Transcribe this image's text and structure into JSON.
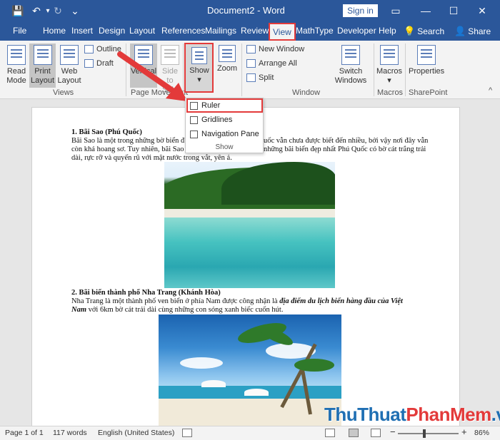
{
  "titlebar": {
    "title": "Document2 - Word",
    "signin": "Sign in",
    "save_icon": "💾",
    "undo_icon": "↶",
    "dropdown_icon": "▾",
    "redo_icon": "↻",
    "customize_icon": "⌄",
    "restore_icon": "▭",
    "minimize_icon": "—",
    "maximize_icon": "☐",
    "close_icon": "✕"
  },
  "tabs": {
    "file": "File",
    "home": "Home",
    "insert": "Insert",
    "design": "Design",
    "layout": "Layout",
    "references": "References",
    "mailings": "Mailings",
    "review": "Review",
    "view": "View",
    "mathtype": "MathType",
    "developer": "Developer",
    "help": "Help",
    "search_icon": "💡",
    "search": "Search",
    "share_icon": "👤",
    "share": "Share"
  },
  "ribbon": {
    "read_mode_1": "Read",
    "read_mode_2": "Mode",
    "print_layout_1": "Print",
    "print_layout_2": "Layout",
    "web_layout_1": "Web",
    "web_layout_2": "Layout",
    "outline": "Outline",
    "draft": "Draft",
    "views_group": "Views",
    "vertical": "Vertical",
    "side_1": "Side",
    "side_2": "to Side",
    "page_movement_group": "Page Movement",
    "show": "Show",
    "zoom": "Zoom",
    "new_window": "New Window",
    "arrange_all": "Arrange All",
    "split": "Split",
    "switch_1": "Switch",
    "switch_2": "Windows",
    "window_group": "Window",
    "macros": "Macros",
    "macros_group": "Macros",
    "properties": "Properties",
    "sharepoint_group": "SharePoint",
    "collapse_icon": "^"
  },
  "dropdown": {
    "ruler": "Ruler",
    "gridlines": "Gridlines",
    "navigation_pane": "Navigation Pane",
    "label": "Show"
  },
  "document": {
    "h1": "1. Bãi Sao (Phú Quốc)",
    "p1_a": "Bãi Sao là  một trong những bờ biển đ",
    "p1_a_right": "uốc vẫn chưa được biết đến nhiều, bởi vậy nơi đây vẫn",
    "p1_b": "còn khá hoang sơ. Tuy nhiên, bãi Sao",
    "p1_b_right": "những bãi biển đẹp nhất  Phú Quốc có bờ cát trắng trải",
    "p1_c": "dài, rực rỡ và quyến rũ với mặt nước trong vắt, yên ả.",
    "h2": "2. Bãi biển thành phố Nha Trang (Khánh Hòa)",
    "p2_a": "Nha Trang là một thành phố ven biển ở phía Nam được công nhận là ",
    "p2_a_bold": "địa điểm du lịch biển hàng đầu của Việt",
    "p2_b_bold": "Nam",
    "p2_b": " với 6km bờ cát trải dài cùng những con sóng xanh biếc cuốn hút."
  },
  "status": {
    "page": "Page 1 of 1",
    "words": "117 words",
    "language": "English (United States)",
    "zoom": "86%",
    "zoom_minus": "−",
    "zoom_plus": "+",
    "zoom_fraction": 0.43
  },
  "watermark": {
    "part1": "ThuThuat",
    "part2": "PhanMem",
    "part3": ".vn",
    "color1": "#1f6fb3",
    "color2": "#e33a3a"
  },
  "colors": {
    "accent": "#2b579a",
    "highlight": "#e33a3a"
  }
}
